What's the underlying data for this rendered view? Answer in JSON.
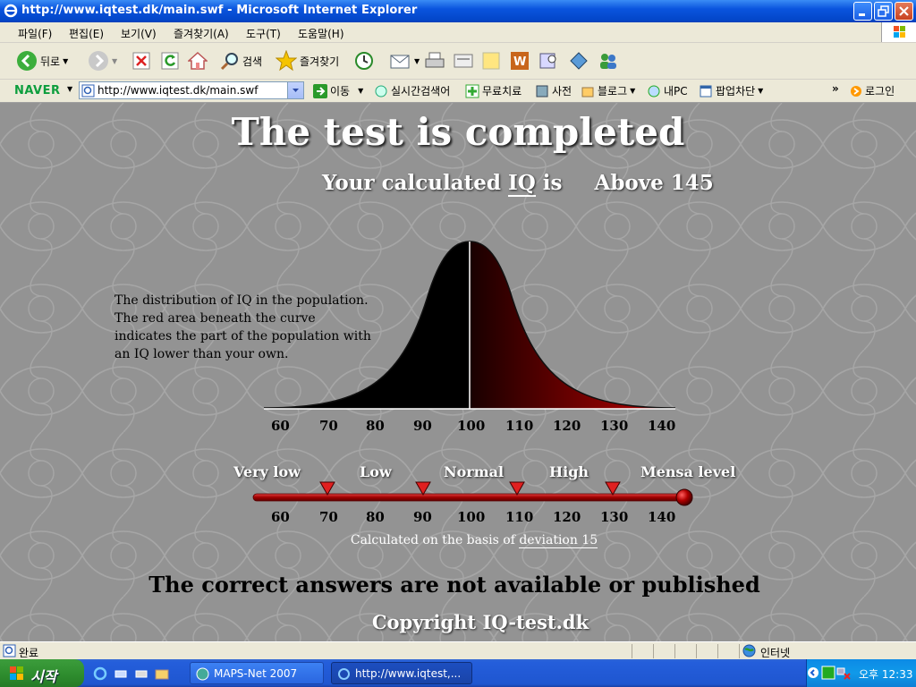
{
  "window": {
    "title": "http://www.iqtest.dk/main.swf - Microsoft Internet Explorer"
  },
  "menu": [
    "파일(F)",
    "편집(E)",
    "보기(V)",
    "즐겨찾기(A)",
    "도구(T)",
    "도움말(H)"
  ],
  "toolbar": {
    "back": "뒤로",
    "search": "검색",
    "favorites": "즐겨찾기"
  },
  "navbar": {
    "brand": "NAVER",
    "address": "http://www.iqtest.dk/main.swf",
    "go": "이동",
    "realtime": "실시간검색어",
    "free": "무료치료",
    "dict": "사전",
    "blog": "블로그",
    "mypc": "내PC",
    "popup": "팝업차단",
    "login": "로그인"
  },
  "page": {
    "title": "The test is completed",
    "sub_prefix": "Your calculated",
    "sub_iq": "IQ",
    "sub_is": "is",
    "result": "Above 145",
    "description": "The distribution of IQ in the population. The red area beneath the curve indicates the part of the population with an IQ lower than your own.",
    "axis": [
      "60",
      "70",
      "80",
      "90",
      "100",
      "110",
      "120",
      "130",
      "140"
    ],
    "levels": [
      "Very low",
      "Low",
      "Normal",
      "High",
      "Mensa level"
    ],
    "note_prefix": "Calculated on the basis of",
    "note_link": "deviation 15",
    "answers": "The correct answers are not available or published",
    "copyright": "Copyright IQ-test.dk"
  },
  "status": {
    "left": "완료",
    "zone": "인터넷"
  },
  "taskbar": {
    "start": "시작",
    "tasks": [
      "MAPS-Net 2007",
      "http://www.iqtest,..."
    ],
    "clock": "오후 12:33"
  },
  "colors": {
    "title_bar": "#0a54de",
    "content_bg": "#939393",
    "accent_red": "#b01010"
  }
}
